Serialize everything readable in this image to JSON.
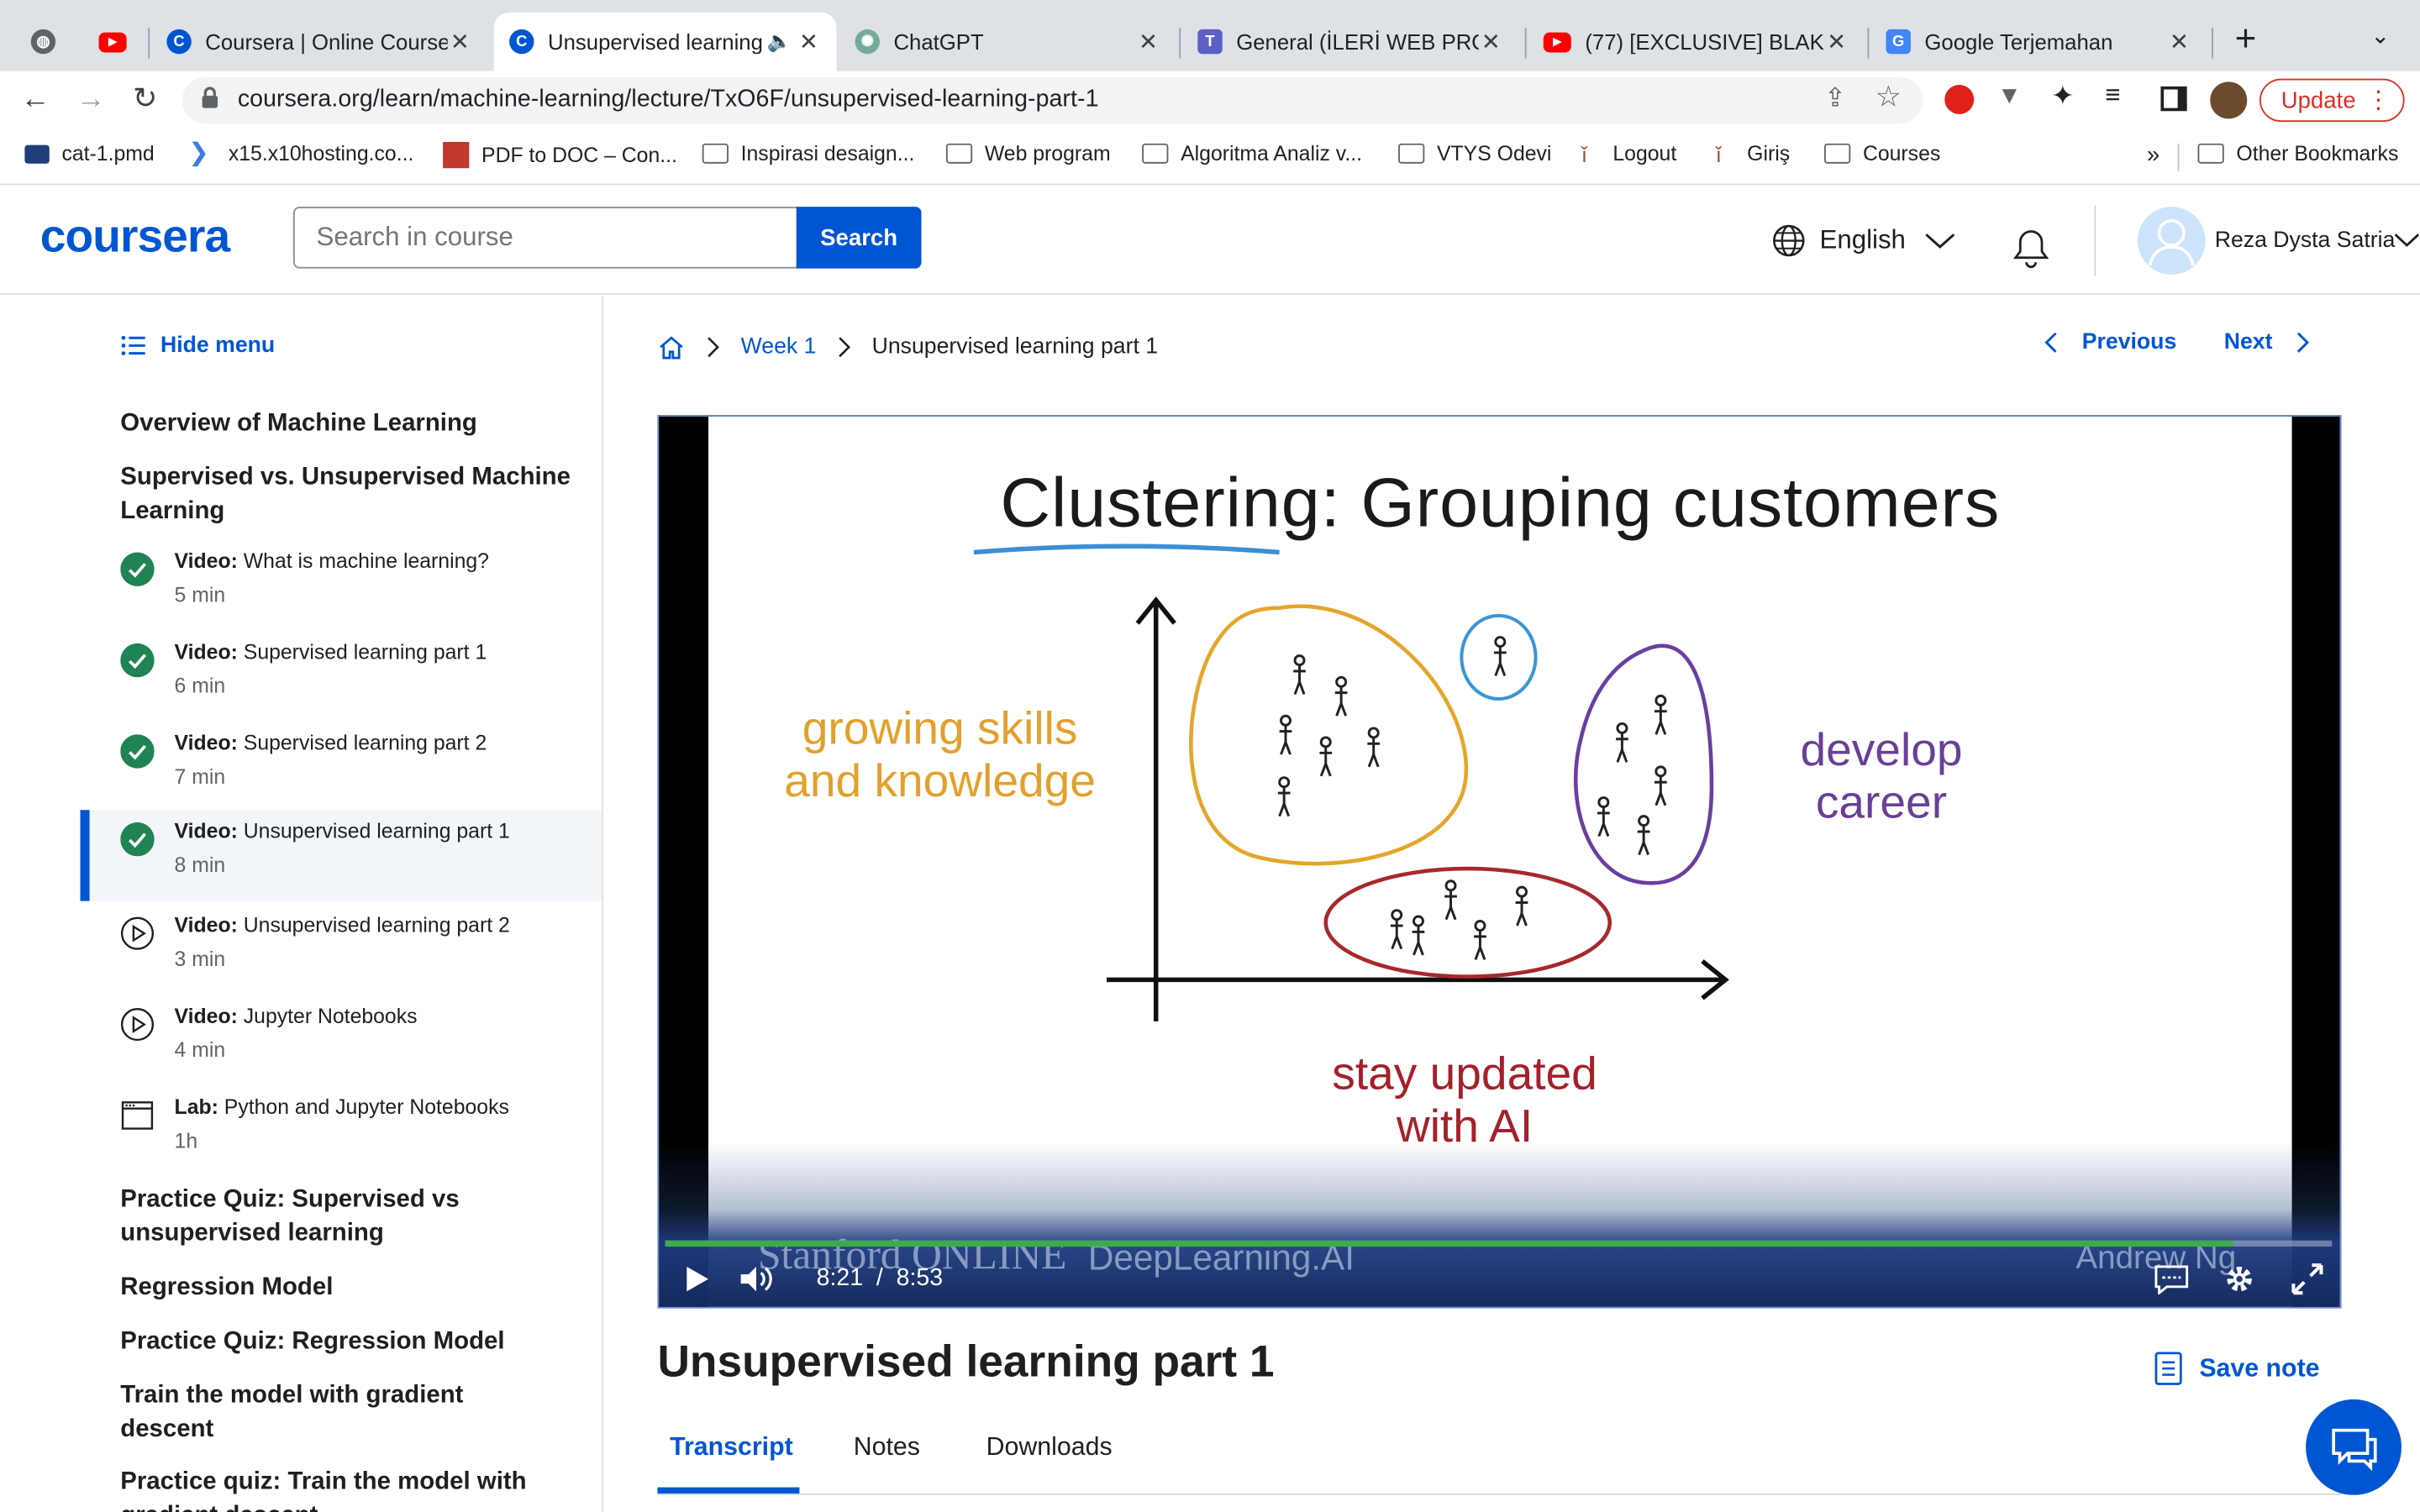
{
  "browser": {
    "tabs": [
      {
        "title": ""
      },
      {
        "title": ""
      },
      {
        "title": "Coursera | Online Courses"
      },
      {
        "title": "Unsupervised learning"
      },
      {
        "title": "ChatGPT"
      },
      {
        "title": "General (İLERİ WEB PROG"
      },
      {
        "title": "(77) [EXCLUSIVE] BLAK"
      },
      {
        "title": "Google Terjemahan"
      }
    ],
    "url": "coursera.org/learn/machine-learning/lecture/TxO6F/unsupervised-learning-part-1",
    "update_label": "Update",
    "bookmarks": [
      "cat-1.pmd",
      "x15.x10hosting.co...",
      "PDF to DOC – Con...",
      "Inspirasi desaign...",
      "Web program",
      "Algoritma Analiz v...",
      "VTYS Odevi",
      "Logout",
      "Giriş",
      "Courses"
    ],
    "more_bookmarks": "»",
    "other_bookmarks": "Other Bookmarks"
  },
  "header": {
    "logo": "coursera",
    "search_placeholder": "Search in course",
    "search_button": "Search",
    "language": "English",
    "user_name": "Reza Dysta Satria"
  },
  "sidebar": {
    "hide_menu": "Hide menu",
    "module1": "Overview of Machine Learning",
    "module2": "Supervised vs. Unsupervised Machine Learning",
    "items": [
      {
        "type": "Video:",
        "title": " What is machine learning?",
        "duration": "5 min",
        "status": "done"
      },
      {
        "type": "Video:",
        "title": " Supervised learning part 1",
        "duration": "6 min",
        "status": "done"
      },
      {
        "type": "Video:",
        "title": " Supervised learning part 2",
        "duration": "7 min",
        "status": "done"
      },
      {
        "type": "Video:",
        "title": " Unsupervised learning part 1",
        "duration": "8 min",
        "status": "current"
      },
      {
        "type": "Video:",
        "title": " Unsupervised learning part 2",
        "duration": "3 min",
        "status": "todo"
      },
      {
        "type": "Video:",
        "title": " Jupyter Notebooks",
        "duration": "4 min",
        "status": "todo"
      },
      {
        "type": "Lab:",
        "title": " Python and Jupyter Notebooks",
        "duration": "1h",
        "status": "lab"
      }
    ],
    "module3": "Practice Quiz: Supervised vs unsupervised learning",
    "module4": "Regression Model",
    "module5": "Practice Quiz: Regression Model",
    "module6": "Train the model with gradient descent",
    "module7": "Practice quiz: Train the model with gradient descent"
  },
  "breadcrumb": {
    "week": "Week 1",
    "current": "Unsupervised learning part 1"
  },
  "nav": {
    "previous": "Previous",
    "next": "Next"
  },
  "slide": {
    "title": "Clustering: Grouping customers",
    "label_left": [
      "growing skills",
      "and knowledge"
    ],
    "label_right": [
      "develop",
      "career"
    ],
    "label_bottom": [
      "stay updated",
      "with AI"
    ],
    "watermark_left": "Stanford ONLINE",
    "watermark_mid": "DeepLearning.AI",
    "watermark_right": "Andrew Ng"
  },
  "player": {
    "current_time": "8:21",
    "separator": "/",
    "total_time": "8:53",
    "progress": 0.941
  },
  "content": {
    "title": "Unsupervised learning part 1",
    "save_note": "Save note",
    "tabs": [
      "Transcript",
      "Notes",
      "Downloads"
    ]
  },
  "colors": {
    "brand": "#0056d2",
    "check": "#1f8354",
    "cluster_orange": "#e4a62a",
    "cluster_purple": "#6b3fa0",
    "cluster_red": "#a7282b",
    "label_orange": "#e3a02b",
    "label_purple": "#6a3f96",
    "label_red": "#a5202a"
  }
}
